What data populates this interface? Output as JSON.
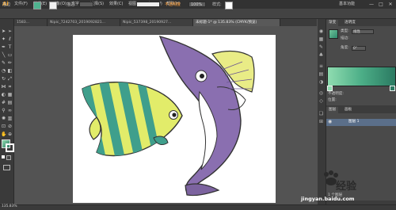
{
  "app": {
    "logo": "Ai",
    "workspace": "基本功能"
  },
  "menu": [
    "文件(F)",
    "编辑(E)",
    "对象(O)",
    "文字(T)",
    "选择(S)",
    "效果(C)",
    "视图(V)",
    "窗口(W)",
    "帮助(H)"
  ],
  "window_buttons": [
    "—",
    "□",
    "✕"
  ],
  "controlbar": {
    "label": "描边",
    "stroke_label": "描边:",
    "stroke_weight_text": "基本",
    "opacity_label": "不透明度:",
    "opacity_value": "100%",
    "style_label": "样式:",
    "orange_text": "不透明度"
  },
  "tabs": [
    {
      "label": "1583...",
      "active": false
    },
    {
      "label": "Nipic_7242703_2019092821...",
      "active": false
    },
    {
      "label": "Nipic_537398_20190927...",
      "active": false
    },
    {
      "label": "未标题-1* @ 135.83% (CMYK/预览)",
      "active": true
    }
  ],
  "gradient_panel": {
    "tabs": [
      "渐变",
      "透明度"
    ],
    "type_label": "类型:",
    "type_value": "线性",
    "stroke_label": "描边:",
    "angle_label": "角度:",
    "angle_value": "0°",
    "opacity_label": "不透明度:",
    "location_label": "位置:"
  },
  "layers_panel": {
    "tabs": [
      "图层",
      "画板"
    ],
    "rows": [
      "图层 1"
    ],
    "footer": "1 个图层"
  },
  "status": {
    "zoom": "135.83%"
  },
  "watermark": {
    "brand": "经验",
    "url": "jingyan.baidu.com"
  },
  "colors": {
    "fish1_stripe": "#3f9f8c",
    "fish1_body": "#e2ec6a",
    "fish2_body": "#8a6fb0",
    "fish2_belly": "#ffffff",
    "fish2_fin": "#e9ec86"
  }
}
